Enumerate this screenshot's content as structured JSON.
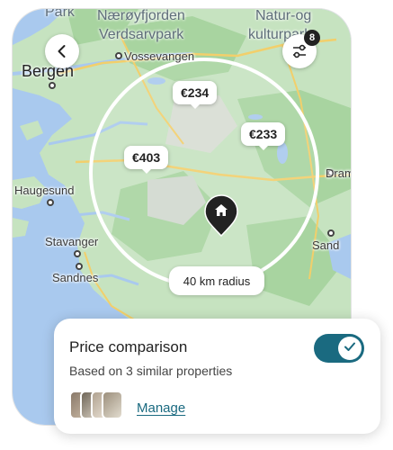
{
  "map": {
    "regions": [
      {
        "id": "park-left",
        "text": "Park"
      },
      {
        "id": "naeroy",
        "text": "Nærøyfjorden"
      },
      {
        "id": "verdsar",
        "text": "Verdsarvpark"
      },
      {
        "id": "natur",
        "text": "Natur-og"
      },
      {
        "id": "kultur",
        "text": "kulturpark"
      }
    ],
    "cities": [
      {
        "id": "vossevangen",
        "text": "Vossevangen"
      },
      {
        "id": "bergen",
        "text": "Bergen"
      },
      {
        "id": "haugesund",
        "text": "Haugesund"
      },
      {
        "id": "stavanger",
        "text": "Stavanger"
      },
      {
        "id": "sandnes",
        "text": "Sandnes"
      },
      {
        "id": "dram",
        "text": "Dram"
      },
      {
        "id": "sand",
        "text": "Sand"
      }
    ]
  },
  "back_button": {
    "icon": "chevron-left-icon"
  },
  "filter_button": {
    "icon": "sliders-icon",
    "badge_count": "8"
  },
  "price_pins": [
    {
      "price": "€234"
    },
    {
      "price": "€233"
    },
    {
      "price": "€403"
    }
  ],
  "home_pin": {
    "icon": "home-icon"
  },
  "radius_label": "40 km radius",
  "price_card": {
    "title": "Price comparison",
    "subtitle": "Based on 3 similar properties",
    "toggle_on": true,
    "manage_label": "Manage",
    "thumbnail_icons": [
      "property-photo-1",
      "property-photo-2",
      "property-photo-3",
      "property-photo-4"
    ]
  },
  "colors": {
    "water": "#a9c9ee",
    "land": "#c6e3c0",
    "forest": "#a8d4a0",
    "accent": "#1a6a80",
    "road": "#f2cf6b"
  }
}
